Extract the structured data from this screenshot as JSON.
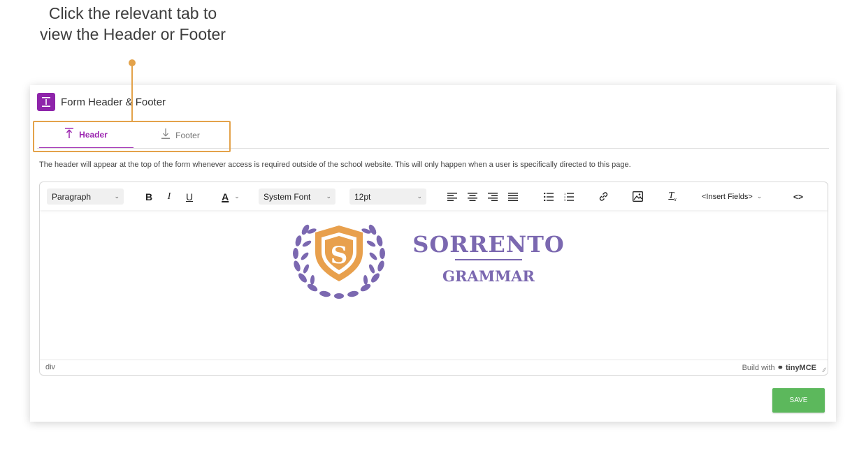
{
  "callout": {
    "text_line1": "Click the relevant tab to",
    "text_line2": "view the Header or Footer"
  },
  "card": {
    "title": "Form Header & Footer",
    "icon": "header-footer-icon"
  },
  "tabs": [
    {
      "label": "Header",
      "icon": "arrow-up-bar-icon",
      "active": true
    },
    {
      "label": "Footer",
      "icon": "arrow-down-bar-icon",
      "active": false
    }
  ],
  "description": "The header will appear at the top of the form whenever access is required outside of the school website. This will only happen when a user is specifically directed to this page.",
  "toolbar": {
    "block_format": "Paragraph",
    "font_family": "System Font",
    "font_size": "12pt",
    "insert_fields": "<Insert Fields>"
  },
  "logo": {
    "line1": "SORRENTO",
    "line2": "GRAMMAR",
    "badge_letter": "S"
  },
  "statusbar": {
    "path": "div",
    "brand_prefix": "Build with",
    "brand_name": "tinyMCE"
  },
  "save_label": "SAVE",
  "colors": {
    "accent": "#9c27b0",
    "callout": "#e3a24a",
    "save": "#5cb85c",
    "logo_purple": "#7b68b0",
    "logo_orange": "#e8a04d"
  }
}
